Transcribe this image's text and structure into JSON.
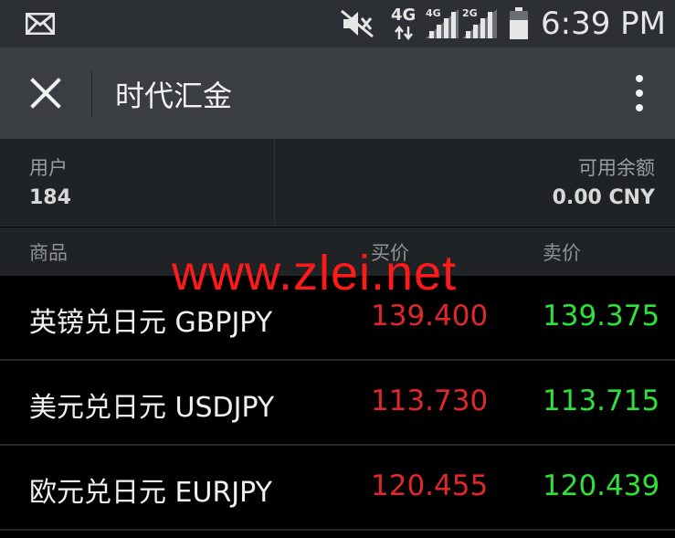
{
  "status_bar": {
    "time": "6:39 PM",
    "network_primary": "4G",
    "sim1_label": "4G",
    "sim2_label": "2G",
    "icons": [
      "mail-icon",
      "mute-icon",
      "data-arrows-icon",
      "signal-icon",
      "battery-icon"
    ]
  },
  "app_bar": {
    "title": "时代汇金",
    "icons": [
      "close-icon",
      "more-vertical-icon"
    ]
  },
  "account": {
    "user_label": "用户",
    "user_value": "184",
    "balance_label": "可用余额",
    "balance_value": "0.00 CNY"
  },
  "table": {
    "headers": {
      "product": "商品",
      "buy": "买价",
      "sell": "卖价"
    },
    "rows": [
      {
        "name": "英镑兑日元 GBPJPY",
        "buy": "139.400",
        "sell": "139.375"
      },
      {
        "name": "美元兑日元 USDJPY",
        "buy": "113.730",
        "sell": "113.715"
      },
      {
        "name": "欧元兑日元 EURJPY",
        "buy": "120.455",
        "sell": "120.439"
      }
    ]
  },
  "watermark": "www.zlei.net",
  "colors": {
    "buy_price": "#e0282b",
    "sell_price": "#2fe03a",
    "app_bar": "#3a3d41",
    "status_bar": "#2c2f33",
    "background": "#000000"
  }
}
